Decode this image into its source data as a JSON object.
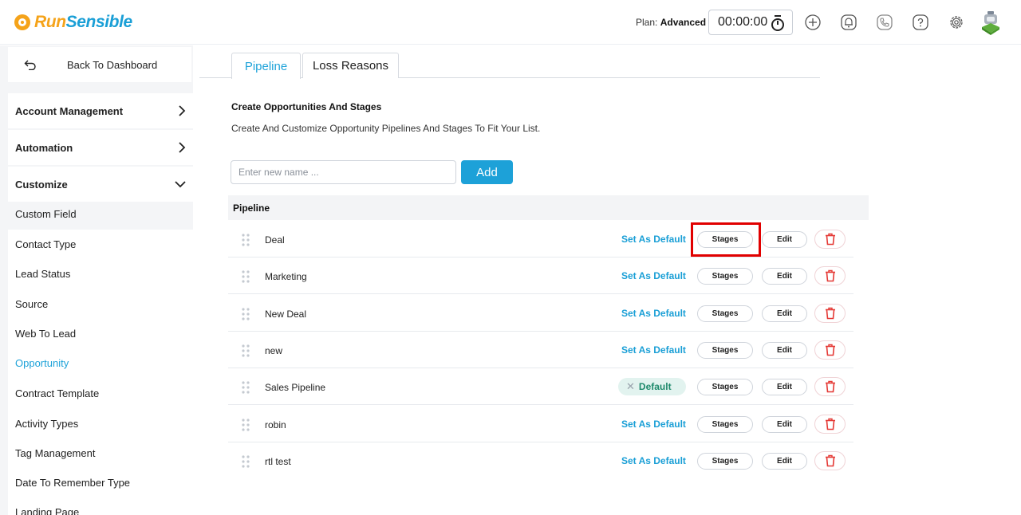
{
  "brand": {
    "part1": "Run",
    "part2": "Sensible"
  },
  "header": {
    "plan_label": "Plan:",
    "plan_value": "Advanced",
    "timer": "00:00:00",
    "icons": [
      "plus-circle-icon",
      "bell-icon",
      "phone-icon",
      "help-icon",
      "gear-icon",
      "avatar"
    ]
  },
  "sidebar": {
    "back_label": "Back To Dashboard",
    "groups": [
      {
        "label": "Account Management",
        "state": "collapsed"
      },
      {
        "label": "Automation",
        "state": "collapsed"
      },
      {
        "label": "Customize",
        "state": "expanded"
      }
    ],
    "items": [
      {
        "label": "Custom Field"
      },
      {
        "label": "Contact Type"
      },
      {
        "label": "Lead Status"
      },
      {
        "label": "Source"
      },
      {
        "label": "Web To Lead"
      },
      {
        "label": "Opportunity",
        "active": true
      },
      {
        "label": "Contract Template"
      },
      {
        "label": "Activity Types"
      },
      {
        "label": "Tag Management"
      },
      {
        "label": "Date To Remember Type"
      },
      {
        "label": "Landing Page"
      }
    ]
  },
  "tabs": [
    {
      "label": "Pipeline",
      "active": true
    },
    {
      "label": "Loss Reasons",
      "active": false
    }
  ],
  "section": {
    "title": "Create Opportunities And Stages",
    "description": "Create And Customize Opportunity Pipelines And Stages To Fit Your List."
  },
  "form": {
    "placeholder": "Enter new name ...",
    "value": "",
    "add_label": "Add"
  },
  "table": {
    "header": "Pipeline",
    "set_default_label": "Set As Default",
    "default_label": "Default",
    "stages_label": "Stages",
    "edit_label": "Edit",
    "rows": [
      {
        "name": "Deal",
        "is_default": false
      },
      {
        "name": "Marketing",
        "is_default": false
      },
      {
        "name": "New Deal",
        "is_default": false
      },
      {
        "name": "new",
        "is_default": false
      },
      {
        "name": "Sales Pipeline",
        "is_default": true
      },
      {
        "name": "robin",
        "is_default": false
      },
      {
        "name": "rtl test",
        "is_default": false
      }
    ]
  },
  "colors": {
    "accent": "#1da1d8",
    "brand_orange": "#f5a31a",
    "default_badge_bg": "#e2f3ef",
    "default_badge_text": "#1f8a6c",
    "delete": "#e53935",
    "highlight": "#e10000"
  }
}
